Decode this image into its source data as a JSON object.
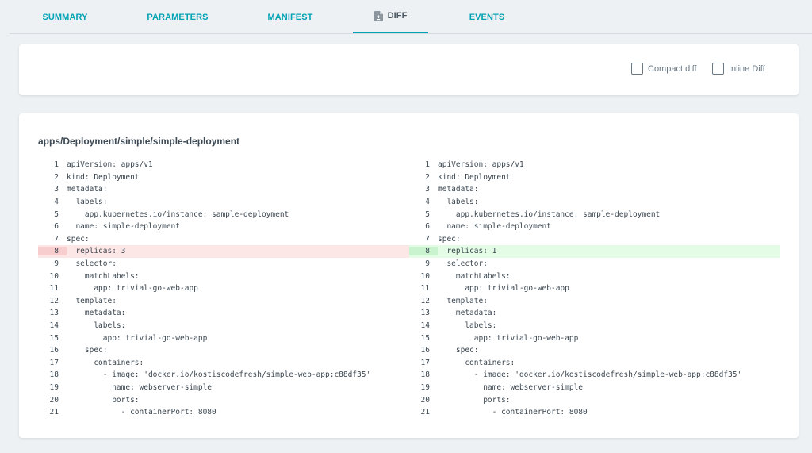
{
  "tabs": [
    {
      "label": "SUMMARY"
    },
    {
      "label": "PARAMETERS"
    },
    {
      "label": "MANIFEST"
    },
    {
      "label": "DIFF",
      "icon": "diff-file-icon",
      "active": true
    },
    {
      "label": "EVENTS"
    }
  ],
  "options": {
    "compact_diff": "Compact diff",
    "inline_diff": "Inline Diff"
  },
  "colors": {
    "accent": "#00a2b3",
    "removed_bg": "#fde6e6",
    "added_bg": "#e4fbe6"
  },
  "resource_title": "apps/Deployment/simple/simple-deployment",
  "diff": {
    "left": [
      {
        "num": "1",
        "code": "apiVersion: apps/v1"
      },
      {
        "num": "2",
        "code": "kind: Deployment"
      },
      {
        "num": "3",
        "code": "metadata:"
      },
      {
        "num": "4",
        "code": "  labels:"
      },
      {
        "num": "5",
        "code": "    app.kubernetes.io/instance: sample-deployment"
      },
      {
        "num": "6",
        "code": "  name: simple-deployment"
      },
      {
        "num": "7",
        "code": "spec:"
      },
      {
        "num": "8",
        "code": "  replicas: 3",
        "status": "removed"
      },
      {
        "num": "9",
        "code": "  selector:"
      },
      {
        "num": "10",
        "code": "    matchLabels:"
      },
      {
        "num": "11",
        "code": "      app: trivial-go-web-app"
      },
      {
        "num": "12",
        "code": "  template:"
      },
      {
        "num": "13",
        "code": "    metadata:"
      },
      {
        "num": "14",
        "code": "      labels:"
      },
      {
        "num": "15",
        "code": "        app: trivial-go-web-app"
      },
      {
        "num": "16",
        "code": "    spec:"
      },
      {
        "num": "17",
        "code": "      containers:"
      },
      {
        "num": "18",
        "code": "        - image: 'docker.io/kostiscodefresh/simple-web-app:c88df35'"
      },
      {
        "num": "19",
        "code": "          name: webserver-simple"
      },
      {
        "num": "20",
        "code": "          ports:"
      },
      {
        "num": "21",
        "code": "            - containerPort: 8080"
      }
    ],
    "right": [
      {
        "num": "1",
        "code": "apiVersion: apps/v1"
      },
      {
        "num": "2",
        "code": "kind: Deployment"
      },
      {
        "num": "3",
        "code": "metadata:"
      },
      {
        "num": "4",
        "code": "  labels:"
      },
      {
        "num": "5",
        "code": "    app.kubernetes.io/instance: sample-deployment"
      },
      {
        "num": "6",
        "code": "  name: simple-deployment"
      },
      {
        "num": "7",
        "code": "spec:"
      },
      {
        "num": "8",
        "code": "  replicas: 1",
        "status": "added"
      },
      {
        "num": "9",
        "code": "  selector:"
      },
      {
        "num": "10",
        "code": "    matchLabels:"
      },
      {
        "num": "11",
        "code": "      app: trivial-go-web-app"
      },
      {
        "num": "12",
        "code": "  template:"
      },
      {
        "num": "13",
        "code": "    metadata:"
      },
      {
        "num": "14",
        "code": "      labels:"
      },
      {
        "num": "15",
        "code": "        app: trivial-go-web-app"
      },
      {
        "num": "16",
        "code": "    spec:"
      },
      {
        "num": "17",
        "code": "      containers:"
      },
      {
        "num": "18",
        "code": "        - image: 'docker.io/kostiscodefresh/simple-web-app:c88df35'"
      },
      {
        "num": "19",
        "code": "          name: webserver-simple"
      },
      {
        "num": "20",
        "code": "          ports:"
      },
      {
        "num": "21",
        "code": "            - containerPort: 8080"
      }
    ]
  }
}
